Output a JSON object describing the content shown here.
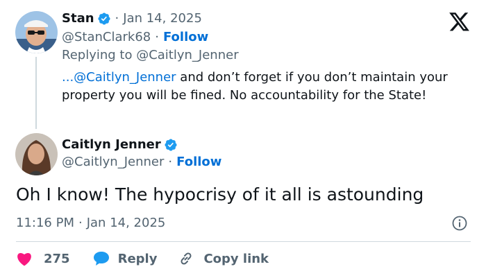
{
  "quoted": {
    "name": "Stan",
    "date": "Jan 14, 2025",
    "handle": "@StanClark68",
    "follow_label": "Follow",
    "replying_prefix": "Replying to ",
    "replying_handle": "@Caitlyn_Jenner",
    "text_mention": "...@Caitlyn_Jenner",
    "text_body": " and don’t forget if you don’t maintain your property you will be fined. No accountability for the State!"
  },
  "tweet": {
    "name": "Caitlyn Jenner",
    "handle": "@Caitlyn_Jenner",
    "follow_label": "Follow",
    "text": "Oh I know! The hypocrisy of it all is astounding",
    "time": "11:16 PM",
    "date": "Jan 14, 2025"
  },
  "actions": {
    "like_count": "275",
    "reply_label": "Reply",
    "copy_label": "Copy link"
  },
  "separators": {
    "dot": "·"
  },
  "icons": {
    "logo": "x-logo-icon",
    "verified": "verified-badge-icon",
    "like": "heart-icon",
    "reply": "reply-bubble-icon",
    "copy": "link-icon",
    "info": "info-icon"
  },
  "colors": {
    "accent": "#1d9bf0",
    "link": "#006fd6",
    "like": "#f91880",
    "muted": "#536471",
    "text": "#0f1419"
  }
}
